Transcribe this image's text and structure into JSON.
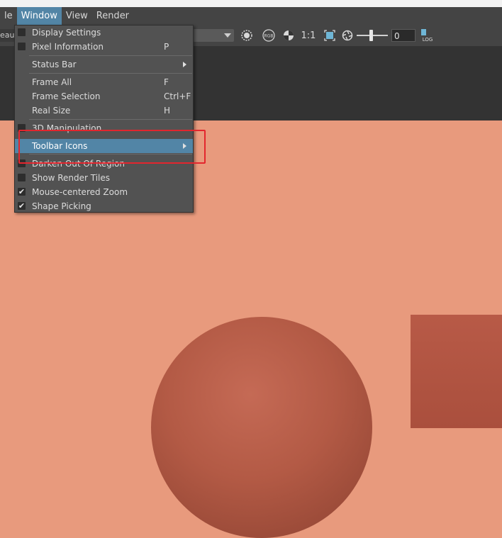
{
  "menubar": {
    "items": [
      "le",
      "Window",
      "View",
      "Render"
    ],
    "active_index": 1
  },
  "toolbar": {
    "lens_text": "eau",
    "ratio_label": "1:1",
    "exposure_value": "0",
    "log_label": "LOG",
    "rgb_label": "RGB"
  },
  "window_menu": {
    "items": [
      {
        "label": "Display Settings",
        "shortcut": "",
        "checkbox": true,
        "checked": false,
        "submenu": false
      },
      {
        "label": "Pixel Information",
        "shortcut": "P",
        "checkbox": true,
        "checked": false,
        "submenu": false
      },
      {
        "label": "Status Bar",
        "shortcut": "",
        "checkbox": false,
        "checked": false,
        "submenu": true
      },
      {
        "label": "Frame All",
        "shortcut": "F",
        "checkbox": false,
        "checked": false,
        "submenu": false
      },
      {
        "label": "Frame Selection",
        "shortcut": "Ctrl+F",
        "checkbox": false,
        "checked": false,
        "submenu": false
      },
      {
        "label": "Real Size",
        "shortcut": "H",
        "checkbox": false,
        "checked": false,
        "submenu": false
      },
      {
        "label": "3D Manipulation",
        "shortcut": "",
        "checkbox": true,
        "checked": false,
        "submenu": false
      },
      {
        "label": "Toolbar Icons",
        "shortcut": "",
        "checkbox": false,
        "checked": false,
        "submenu": true,
        "highlighted": true
      },
      {
        "label": "Darken Out Of Region",
        "shortcut": "",
        "checkbox": true,
        "checked": false,
        "submenu": false
      },
      {
        "label": "Show Render Tiles",
        "shortcut": "",
        "checkbox": true,
        "checked": false,
        "submenu": false
      },
      {
        "label": "Mouse-centered Zoom",
        "shortcut": "",
        "checkbox": true,
        "checked": true,
        "submenu": false
      },
      {
        "label": "Shape Picking",
        "shortcut": "",
        "checkbox": true,
        "checked": true,
        "submenu": false
      }
    ]
  },
  "colors": {
    "menu_bg": "#525252",
    "highlight": "#5285a6",
    "annotation": "#e3262e",
    "viewport_bg": "#e89a7d"
  }
}
